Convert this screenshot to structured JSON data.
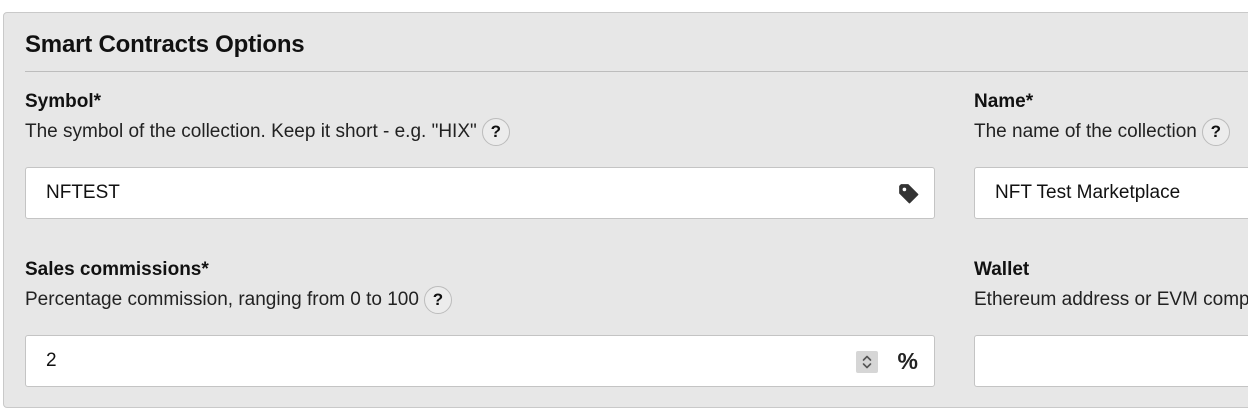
{
  "panel": {
    "title": "Smart Contracts Options"
  },
  "fields": {
    "symbol": {
      "label": "Symbol*",
      "help": "The symbol of the collection. Keep it short - e.g. \"HIX\"",
      "help_icon": "?",
      "value": "NFTEST",
      "icon": "tag-icon"
    },
    "name": {
      "label": "Name*",
      "help": "The name of the collection",
      "help_icon": "?",
      "value": "NFT Test Marketplace"
    },
    "sales_commissions": {
      "label": "Sales commissions*",
      "help": "Percentage commission, ranging from 0 to 100",
      "help_icon": "?",
      "value": "2",
      "suffix": "%",
      "icon": "spinner-icon"
    },
    "wallet": {
      "label": "Wallet",
      "help": "Ethereum address or EVM comp",
      "value": ""
    }
  }
}
